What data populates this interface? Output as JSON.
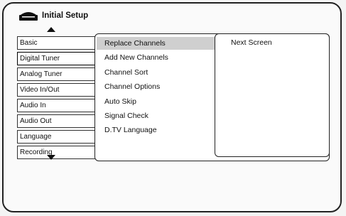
{
  "header": {
    "title": "Initial Setup",
    "icon": "dvd-recorder-icon"
  },
  "sidebar": {
    "items": [
      {
        "label": "Basic"
      },
      {
        "label": "Digital Tuner",
        "active": true
      },
      {
        "label": "Analog Tuner"
      },
      {
        "label": "Video In/Out"
      },
      {
        "label": "Audio In"
      },
      {
        "label": "Audio Out"
      },
      {
        "label": "Language"
      },
      {
        "label": "Recording"
      }
    ]
  },
  "menu": {
    "items": [
      {
        "label": "Replace Channels",
        "selected": true
      },
      {
        "label": "Add New Channels"
      },
      {
        "label": "Channel Sort"
      },
      {
        "label": "Channel Options"
      },
      {
        "label": "Auto Skip"
      },
      {
        "label": "Signal Check"
      },
      {
        "label": "D.TV Language"
      }
    ]
  },
  "submenu": {
    "text": "Next Screen"
  }
}
